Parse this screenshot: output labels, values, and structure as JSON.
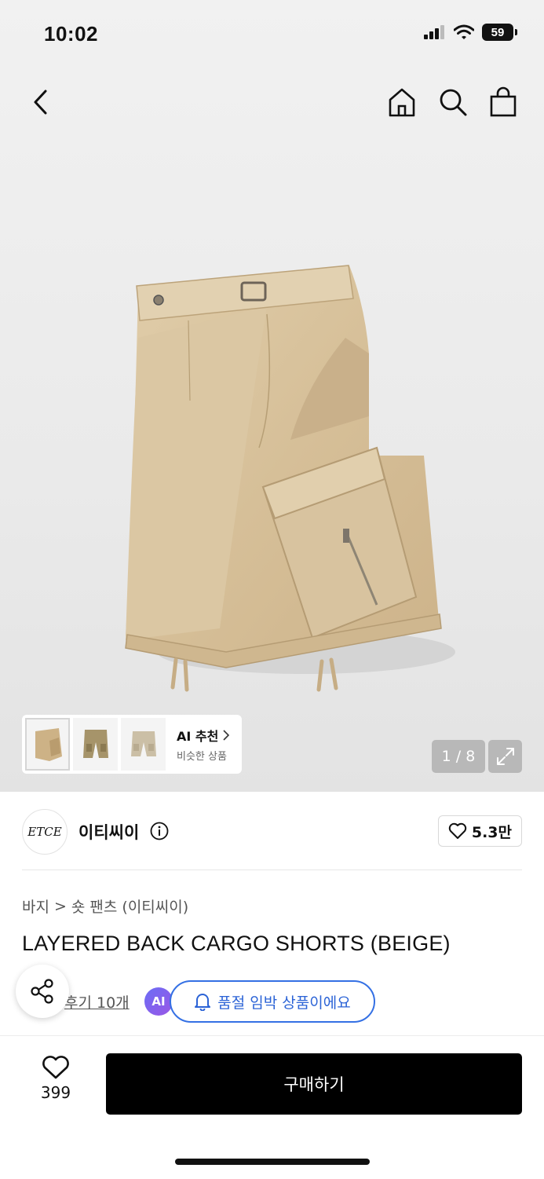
{
  "status_bar": {
    "time": "10:02",
    "battery": "59"
  },
  "gallery": {
    "counter": "1 / 8"
  },
  "ai_recommend": {
    "title": "AI 추천",
    "subtitle": "비슷한 상품"
  },
  "brand": {
    "logo_text": "ETCE",
    "name": "이티씨이",
    "likes": "5.3만"
  },
  "breadcrumb": {
    "category": "바지",
    "separator": ">",
    "subcategory": "숏 팬츠 (이티씨이)"
  },
  "product": {
    "title": "LAYERED BACK CARGO SHORTS (BEIGE)",
    "review_link": "후기 10개",
    "ai_badge": "AI",
    "soldout_notice": "품절 임박 상품이에요"
  },
  "bottom_bar": {
    "wish_count": "399",
    "buy_label": "구매하기"
  },
  "colors": {
    "accent_blue": "#2b63d6",
    "buy_button": "#000000",
    "fabric_beige": "#d9c3a0"
  }
}
